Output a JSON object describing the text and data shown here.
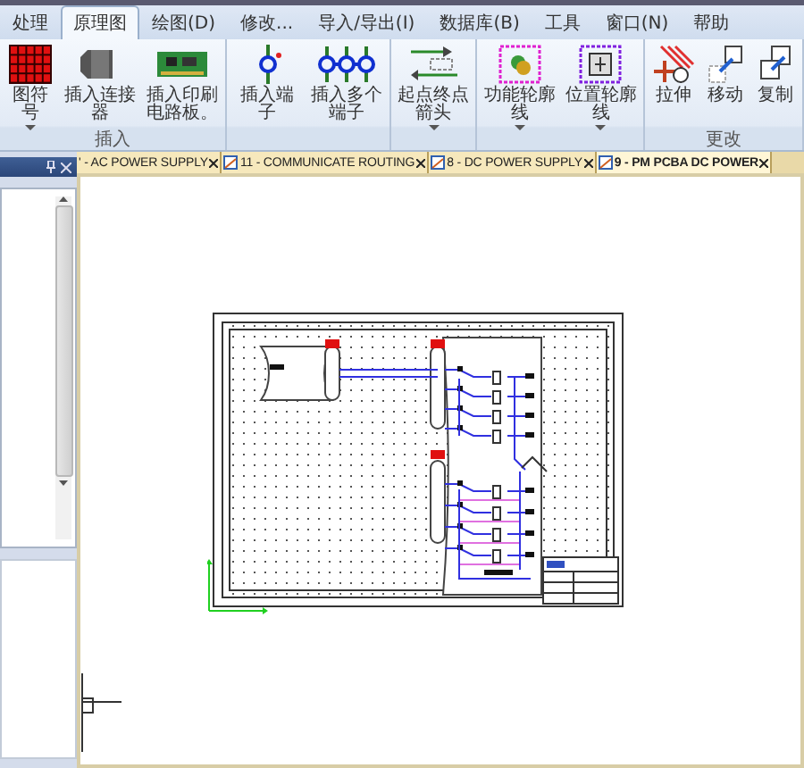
{
  "menu_tabs": [
    {
      "label": "处理",
      "selected": false
    },
    {
      "label": "原理图",
      "selected": true
    },
    {
      "label": "绘图(D)",
      "selected": false
    },
    {
      "label": "修改...",
      "selected": false
    },
    {
      "label": "导入/导出(I)",
      "selected": false
    },
    {
      "label": "数据库(B)",
      "selected": false
    },
    {
      "label": "工具",
      "selected": false
    },
    {
      "label": "窗口(N)",
      "selected": false
    },
    {
      "label": "帮助",
      "selected": false
    }
  ],
  "ribbon_groups": [
    {
      "label": "插入",
      "buttons": [
        {
          "label": "图符号",
          "kind": "grid",
          "dropdown": true
        },
        {
          "label": "插入连接器",
          "kind": "connector",
          "dropdown": false
        },
        {
          "label": "插入印刷电路板。",
          "kind": "pcb",
          "dropdown": false
        }
      ]
    },
    {
      "buttons": [
        {
          "label": "插入端子",
          "kind": "terminal",
          "dropdown": false
        },
        {
          "label": "插入多个端子",
          "kind": "terminals",
          "dropdown": false
        }
      ]
    },
    {
      "buttons": [
        {
          "label": "起点终点箭头",
          "kind": "arrows",
          "dropdown": true
        }
      ]
    },
    {
      "buttons": [
        {
          "label": "功能轮廓线",
          "kind": "func-outline",
          "dropdown": true
        },
        {
          "label": "位置轮廓线",
          "kind": "pos-outline",
          "dropdown": true
        }
      ]
    },
    {
      "label": "更改",
      "buttons": [
        {
          "label": "拉伸",
          "kind": "stretch",
          "dropdown": false
        },
        {
          "label": "移动",
          "kind": "move",
          "dropdown": false
        },
        {
          "label": "复制",
          "kind": "copy",
          "dropdown": false
        }
      ]
    }
  ],
  "document_tabs": [
    {
      "label": "' - AC POWER SUPPLY",
      "icon": false,
      "selected": false
    },
    {
      "label": "11 - COMMUNICATE ROUTING",
      "icon": true,
      "selected": false
    },
    {
      "label": "8 - DC POWER SUPPLY",
      "icon": true,
      "selected": false
    },
    {
      "label": "9 - PM PCBA DC POWER",
      "icon": true,
      "selected": true
    }
  ]
}
